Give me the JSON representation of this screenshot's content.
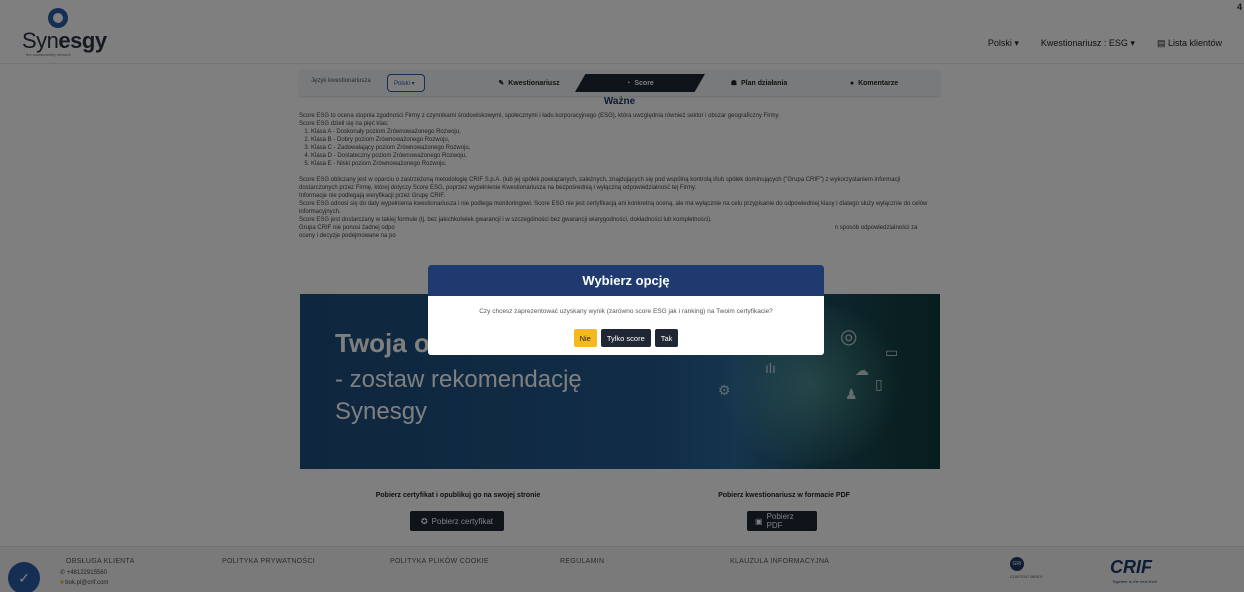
{
  "header": {
    "logo_text_light": "Syn",
    "logo_text_bold": "esgy",
    "logo_tagline": "the sustainability network",
    "nav": {
      "language": "Polski ▾",
      "questionnaire": "Kwestionariusz : ESG ▾",
      "clients": "Lista klientów"
    },
    "corner_number": "4"
  },
  "toolbar": {
    "lang_label": "Język kwestionariusza",
    "lang_value": "Polski ▾",
    "tabs": [
      "Kwestionariusz",
      "Score",
      "Plan działania",
      "Komentarze"
    ]
  },
  "main": {
    "title": "Ważne",
    "p1": "Score ESG to ocena stopnia zgodności Firmy z czynnikami środowiskowymi, społecznymi i ładu korporacyjnego (ESG), która uwzględnia również sektor i obszar geograficzny Firmy.",
    "p2": "Score ESG dzieli się na pięć klas:",
    "classes": [
      "Klasa A - Doskonały poziom Zrównoważonego Rozwoju,",
      "Klasa B - Dobry poziom Zrównoważonego Rozwoju,",
      "Klasa C - Zadowalający poziom Zrównoważonego Rozwoju,",
      "Klasa D - Dostateczny poziom Zrównoważonego Rozwoju,",
      "Klasa E - Niski poziom Zrównoważonego Rozwoju."
    ],
    "p3": "Score ESG obliczany jest w oparciu o zastrzeżoną metodologię CRIF S.p.A. (lub jej spółek powiązanych, zależnych, znajdujących się pod wspólną kontrolą i/lub spółek dominujących (\"Grupa CRIF\") z wykorzystaniem informacji dostarczonych przez Firmę, której dotyczy Score ESG, poprzez wypełnienie Kwestionariusza na bezpośrednią i wyłączną odpowiedzialność tej Firmy.",
    "p4": "Informacje nie podlegają weryfikacji przez Grupę CRIF.",
    "p5": "Score ESG odnosi się do daty wypełnienia kwestionariusza i nie podlega monitoringowi. Score ESG nie jest certyfikacją ani konkretną oceną, ale ma wyłącznie na celu przypisanie do odpowiedniej klasy i dlatego służy wyłącznie do celów informacyjnych.",
    "p6": "Score ESG jest dostarczany w takiej formule (tj. bez jakichkolwiek gwarancji i w szczególności bez gwarancji wiarygodności, dokładności lub kompletności).",
    "p7a": "Grupa CRIF nie ponosi żadnej odpo",
    "p7b": "n sposób odpowiedzialności za",
    "p8": "oceny i decyzje podejmowane na po"
  },
  "banner": {
    "line1": "Twoja o",
    "line2": "- zostaw rekomendację",
    "line3": "Synesgy"
  },
  "downloads": {
    "cert_label": "Pobierz certyfikat i opublikuj go na swojej stronie",
    "cert_button": "Pobierz certyfikat",
    "pdf_label": "Pobierz kwestionariusz w formacie PDF",
    "pdf_button": "Pobierz PDF"
  },
  "footer": {
    "headings": [
      "OBSŁUGA KLIENTA",
      "POLITYKA PRYWATNOŚCI",
      "POLITYKA PLIKÓW COOKIE",
      "REGULAMIN",
      "KLAUZULA INFORMACYJNA"
    ],
    "phone": "+48122915560",
    "email": "bok.pl@crif.com",
    "gri_text": "GRI",
    "gri_caption": "CONTENT INDEX",
    "crif_logo": "CRIF",
    "crif_tagline": "Together to the next level"
  },
  "modal": {
    "title": "Wybierz opcję",
    "message": "Czy chcesz zaprezentować uzyskany wynik (zarówno score ESG jak i ranking) na Twoim certyfikacie?",
    "buttons": {
      "no": "Nie",
      "score_only": "Tylko score",
      "yes": "Tak"
    }
  },
  "colors": {
    "accent": "#1f3a6e",
    "dark": "#1f2735",
    "warning": "#f5b820"
  }
}
